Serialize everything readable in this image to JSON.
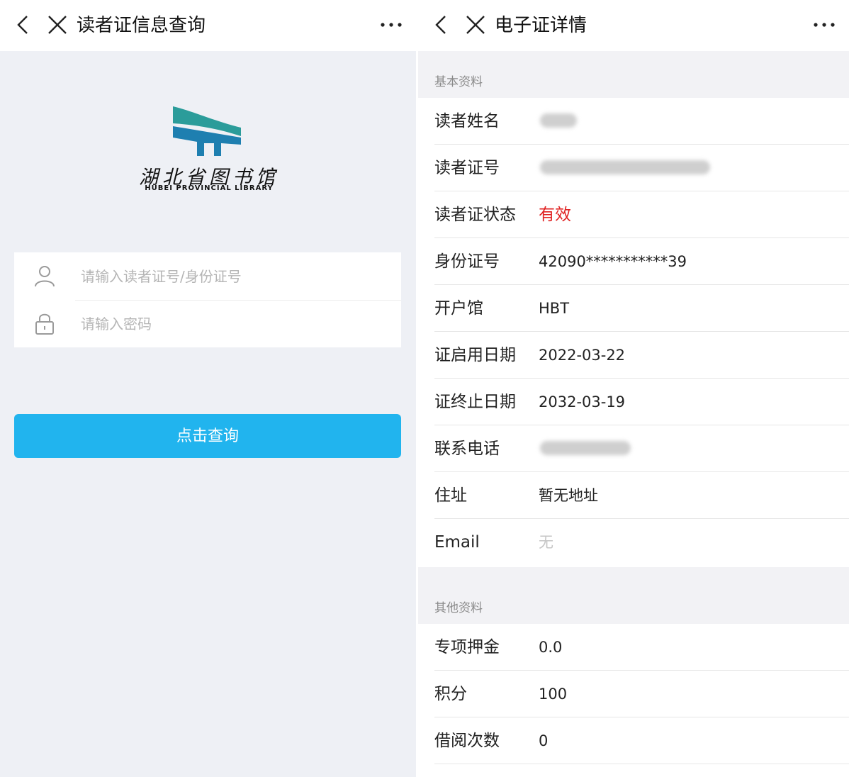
{
  "left": {
    "title": "读者证信息查询",
    "logo_cn": "湖北省图书馆",
    "logo_en": "HUBEI PROVINCIAL LIBRARY",
    "card_placeholder": "请输入读者证号/身份证号",
    "password_placeholder": "请输入密码",
    "query_button": "点击查询",
    "colors": {
      "button": "#21b4ee",
      "logo_blue": "#1e7fb0",
      "logo_teal": "#2b9c9a"
    }
  },
  "right": {
    "title": "电子证详情",
    "basic_section": "基本资料",
    "basic_rows": [
      {
        "label": "读者姓名",
        "value": ""
      },
      {
        "label": "读者证号",
        "value": ""
      },
      {
        "label": "读者证状态",
        "value": "有效"
      },
      {
        "label": "身份证号",
        "value": "42090***********39"
      },
      {
        "label": "开户馆",
        "value": "HBT"
      },
      {
        "label": "证启用日期",
        "value": "2022-03-22"
      },
      {
        "label": "证终止日期",
        "value": "2032-03-19"
      },
      {
        "label": "联系电话",
        "value": ""
      },
      {
        "label": "住址",
        "value": "暂无地址"
      },
      {
        "label": "Email",
        "value": "无"
      }
    ],
    "other_section": "其他资料",
    "other_rows": [
      {
        "label": "专项押金",
        "value": "0.0"
      },
      {
        "label": "积分",
        "value": "100"
      },
      {
        "label": "借阅次数",
        "value": "0"
      }
    ],
    "colors": {
      "status_valid": "#e02222"
    }
  }
}
